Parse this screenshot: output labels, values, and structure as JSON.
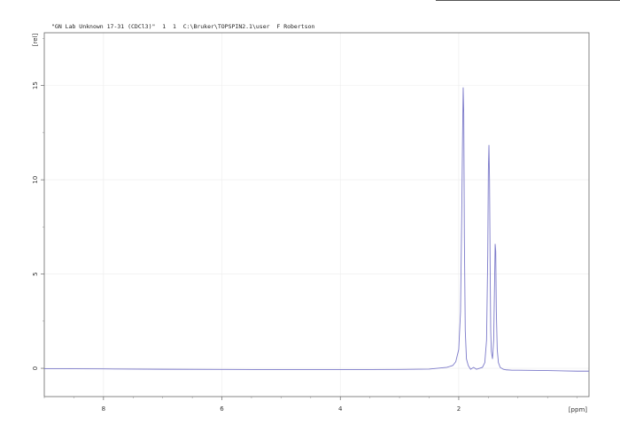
{
  "chart_data": {
    "type": "line",
    "title": "\"GN Lab Unknown 17-31 (CDCl3)\"  1  1  C:\\Bruker\\TOPSPIN2.1\\user  F Robertson",
    "xlabel": "[ppm]",
    "ylabel": "[rel]",
    "xlim": [
      9.0,
      -0.2
    ],
    "ylim": [
      -1.5,
      17.8
    ],
    "x_ticks": [
      8,
      6,
      4,
      2
    ],
    "x_tick_labels": [
      "8",
      "6",
      "4",
      "2"
    ],
    "y_ticks": [
      0,
      5,
      10,
      15
    ],
    "y_tick_labels": [
      "0",
      "5",
      "10",
      "15"
    ],
    "grid": true,
    "series": [
      {
        "color": "#7b79c9",
        "x": [
          9.0,
          8.0,
          7.0,
          6.0,
          5.0,
          4.0,
          3.0,
          2.5,
          2.2,
          2.1,
          2.05,
          2.0,
          1.97,
          1.95,
          1.935,
          1.925,
          1.915,
          1.905,
          1.89,
          1.87,
          1.84,
          1.8,
          1.75,
          1.7,
          1.65,
          1.6,
          1.56,
          1.53,
          1.51,
          1.5,
          1.49,
          1.48,
          1.47,
          1.46,
          1.45,
          1.43,
          1.41,
          1.395,
          1.385,
          1.375,
          1.365,
          1.35,
          1.33,
          1.3,
          1.25,
          1.2,
          1.1,
          1.0,
          0.5,
          0.0,
          -0.2
        ],
        "y": [
          -0.02,
          -0.03,
          -0.05,
          -0.06,
          -0.07,
          -0.07,
          -0.06,
          -0.04,
          0.05,
          0.15,
          0.35,
          1.0,
          3.0,
          8.0,
          12.4,
          14.9,
          13.5,
          7.0,
          2.0,
          0.5,
          0.15,
          -0.05,
          0.05,
          -0.05,
          0.0,
          0.05,
          0.3,
          1.5,
          6.0,
          10.5,
          11.85,
          10.0,
          5.5,
          2.0,
          0.9,
          0.5,
          1.5,
          4.5,
          6.6,
          6.2,
          3.0,
          1.0,
          0.3,
          0.05,
          -0.05,
          -0.08,
          -0.1,
          -0.1,
          -0.12,
          -0.15,
          -0.15
        ]
      }
    ]
  }
}
